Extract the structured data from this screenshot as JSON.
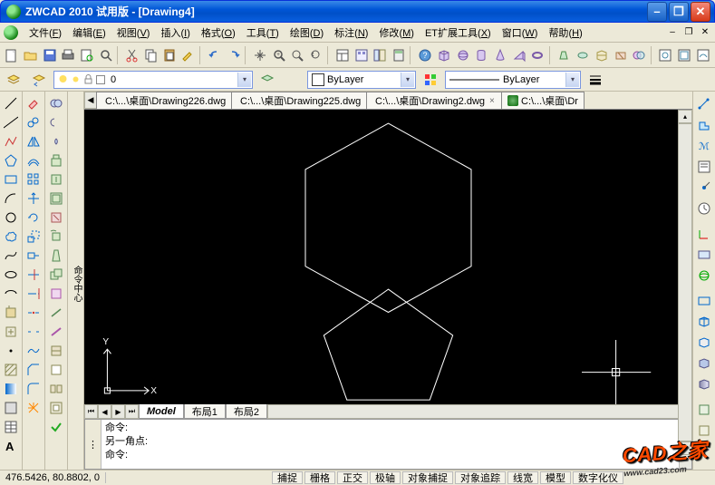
{
  "window": {
    "title": "ZWCAD 2010 试用版 - [Drawing4]",
    "min_symbol": "–",
    "max_symbol": "❐",
    "close_symbol": "✕"
  },
  "menus": [
    {
      "label": "文件",
      "key": "F"
    },
    {
      "label": "编辑",
      "key": "E"
    },
    {
      "label": "视图",
      "key": "V"
    },
    {
      "label": "插入",
      "key": "I"
    },
    {
      "label": "格式",
      "key": "O"
    },
    {
      "label": "工具",
      "key": "T"
    },
    {
      "label": "绘图",
      "key": "D"
    },
    {
      "label": "标注",
      "key": "N"
    },
    {
      "label": "修改",
      "key": "M"
    },
    {
      "label": "ET扩展工具",
      "key": "X"
    },
    {
      "label": "窗口",
      "key": "W"
    },
    {
      "label": "帮助",
      "key": "H"
    }
  ],
  "props": {
    "layer": "0",
    "color_label": "ByLayer",
    "linetype_label": "ByLayer"
  },
  "doc_tabs": [
    {
      "label": "C:\\...\\桌面\\Drawing226.dwg"
    },
    {
      "label": "C:\\...\\桌面\\Drawing225.dwg"
    },
    {
      "label": "C:\\...\\桌面\\Drawing2.dwg"
    },
    {
      "label": "C:\\...\\桌面\\Dr"
    }
  ],
  "layout_tabs": {
    "model": "Model",
    "l1": "布局1",
    "l2": "布局2"
  },
  "ucs": {
    "x": "X",
    "y": "Y"
  },
  "cmd": {
    "line1": "命令:",
    "line2": "另一角点:",
    "line3": "命令:"
  },
  "status": {
    "coords": "476.5426, 80.8802, 0",
    "buttons": [
      "捕捉",
      "栅格",
      "正交",
      "极轴",
      "对象捕捉",
      "对象追踪",
      "线宽",
      "模型",
      "数字化仪"
    ]
  },
  "watermark": {
    "big": "CAD之家",
    "sub": "www.cad23.com"
  }
}
